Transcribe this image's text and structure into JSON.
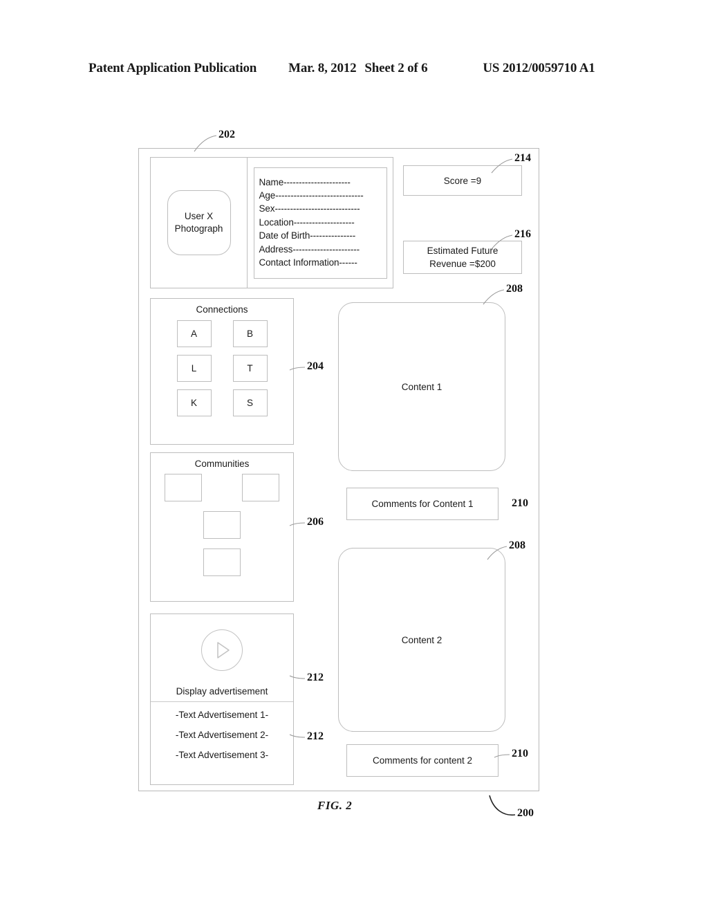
{
  "header": {
    "title": "Patent Application Publication",
    "date": "Mar. 8, 2012",
    "sheet": "Sheet 2 of 6",
    "pub_number": "US 2012/0059710 A1"
  },
  "figure": {
    "label": "FIG. 2",
    "ref_frame": "200"
  },
  "profile": {
    "ref": "202",
    "photo_line1": "User X",
    "photo_line2": "Photograph",
    "fields": [
      "Name----------------------",
      "Age-----------------------------",
      "Sex----------------------------",
      "Location--------------------",
      "Date of Birth---------------",
      "Address----------------------",
      "Contact Information------"
    ]
  },
  "score": {
    "ref": "214",
    "label": "Score =9"
  },
  "revenue": {
    "ref": "216",
    "line1": "Estimated Future",
    "line2": "Revenue =$200"
  },
  "connections": {
    "ref": "204",
    "title": "Connections",
    "items": [
      "A",
      "B",
      "L",
      "T",
      "K",
      "S"
    ]
  },
  "communities": {
    "ref": "206",
    "title": "Communities",
    "boxes": [
      "",
      "",
      "",
      ""
    ]
  },
  "advertisement": {
    "ref_display": "212",
    "ref_text": "212",
    "play_icon": "play-icon",
    "display_label": "Display advertisement",
    "text_ads": [
      "-Text Advertisement 1-",
      "-Text Advertisement 2-",
      "-Text Advertisement 3-"
    ]
  },
  "content": {
    "items": [
      {
        "ref": "208",
        "label": "Content 1"
      },
      {
        "ref": "208",
        "label": "Content 2"
      }
    ]
  },
  "comments": {
    "items": [
      {
        "ref": "210",
        "label": "Comments for Content 1"
      },
      {
        "ref": "210",
        "label": "Comments for content 2"
      }
    ]
  },
  "colors": {
    "line": "#bdbdbd",
    "text": "#1a1a1a",
    "frame": "#b9b9b9"
  }
}
